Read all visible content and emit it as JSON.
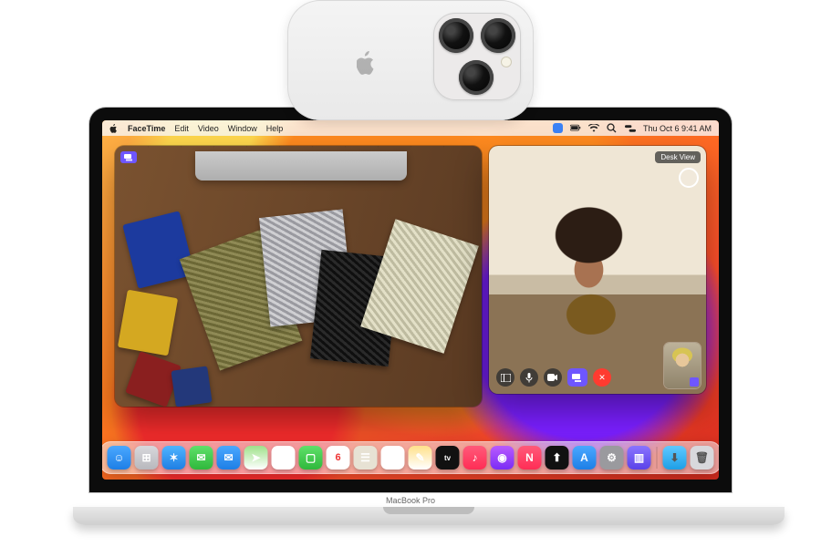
{
  "hardware": {
    "laptop_model": "MacBook Pro"
  },
  "menu_bar": {
    "app_name": "FaceTime",
    "items": [
      "Edit",
      "Video",
      "Window",
      "Help"
    ],
    "clock": "Thu Oct 6  9:41 AM"
  },
  "desk_view_window": {
    "indicator": "desk-view-icon"
  },
  "facetime_window": {
    "badge": "Desk View",
    "controls": {
      "sidebar": "sidebar-icon",
      "mute": "mic-icon",
      "camera": "video-icon",
      "share": "share-screen-icon",
      "end": "end-call-icon"
    }
  },
  "dock": {
    "apps": [
      {
        "name": "finder",
        "bg": "linear-gradient(#4aa8ff,#1e7fe6)",
        "glyph": "☺"
      },
      {
        "name": "launchpad",
        "bg": "linear-gradient(#d8d8dc,#b8b8bd)",
        "glyph": "⊞"
      },
      {
        "name": "safari",
        "bg": "linear-gradient(#4fb4ff,#1f7fe3)",
        "glyph": "✶"
      },
      {
        "name": "messages",
        "bg": "linear-gradient(#5fe06a,#2fb83c)",
        "glyph": "✉"
      },
      {
        "name": "mail",
        "bg": "linear-gradient(#4aa8ff,#1e7fe6)",
        "glyph": "✉"
      },
      {
        "name": "maps",
        "bg": "linear-gradient(#9fe18a,#fff)",
        "glyph": "➤"
      },
      {
        "name": "photos",
        "bg": "#fff",
        "glyph": "✿"
      },
      {
        "name": "facetime",
        "bg": "linear-gradient(#5fe06a,#2fb83c)",
        "glyph": "▢"
      },
      {
        "name": "calendar",
        "bg": "#fff",
        "glyph": "6"
      },
      {
        "name": "contacts",
        "bg": "#e7e2d4",
        "glyph": "☰"
      },
      {
        "name": "reminders",
        "bg": "#fff",
        "glyph": "☑"
      },
      {
        "name": "notes",
        "bg": "linear-gradient(#ffe08a,#fff)",
        "glyph": "✎"
      },
      {
        "name": "tv",
        "bg": "#111",
        "glyph": "tv"
      },
      {
        "name": "music",
        "bg": "linear-gradient(#ff5a7a,#ff2d55)",
        "glyph": "♪"
      },
      {
        "name": "podcasts",
        "bg": "linear-gradient(#b95bff,#7a2cf5)",
        "glyph": "◉"
      },
      {
        "name": "news",
        "bg": "linear-gradient(#ff5a7a,#ff2d55)",
        "glyph": "N"
      },
      {
        "name": "stocks",
        "bg": "#111",
        "glyph": "⬆"
      },
      {
        "name": "appstore",
        "bg": "linear-gradient(#4aa8ff,#1e7fe6)",
        "glyph": "A"
      },
      {
        "name": "settings",
        "bg": "#9a9a9e",
        "glyph": "⚙"
      },
      {
        "name": "desk-view",
        "bg": "linear-gradient(#8a74ff,#5a42e8)",
        "glyph": "▥"
      }
    ],
    "right": [
      {
        "name": "downloads",
        "bg": "linear-gradient(#5fc9ff,#1e9fe6)",
        "glyph": "⬇"
      },
      {
        "name": "trash",
        "bg": "#d8d8dc",
        "glyph": "🗑"
      }
    ]
  },
  "colors": {
    "accent_purple": "#6e56ff",
    "end_red": "#ff3b30",
    "facetime_green": "#2fb83c"
  }
}
